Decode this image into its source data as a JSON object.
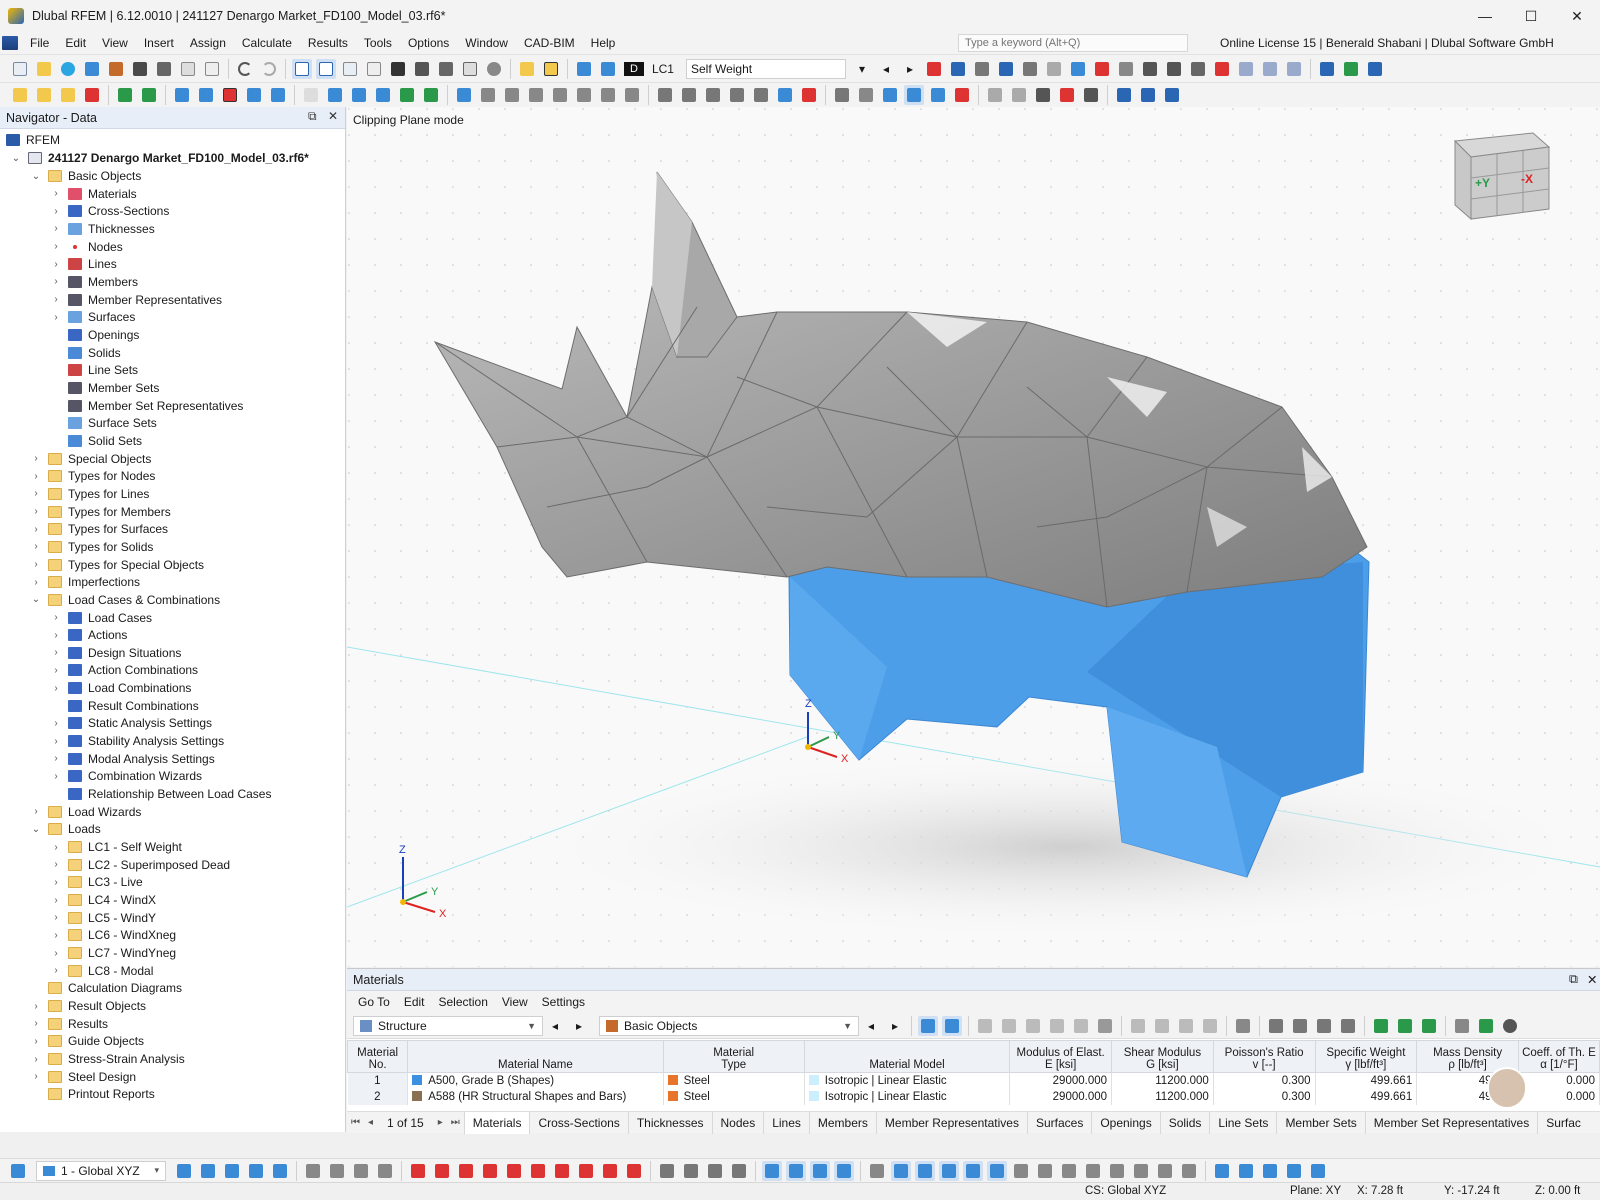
{
  "window": {
    "title": "Dlubal RFEM | 6.12.0010 | 241127 Denargo Market_FD100_Model_03.rf6*",
    "controls": [
      "—",
      "☐",
      "✕"
    ]
  },
  "menu": {
    "items": [
      "File",
      "Edit",
      "View",
      "Insert",
      "Assign",
      "Calculate",
      "Results",
      "Tools",
      "Options",
      "Window",
      "CAD-BIM",
      "Help"
    ],
    "search_placeholder": "Type a keyword (Alt+Q)",
    "license": "Online License 15 | Benerald Shabani | Dlubal Software GmbH"
  },
  "toolbar": {
    "load_case_badge": "D",
    "load_case_id": "LC1",
    "load_case_name": "Self Weight"
  },
  "navigator": {
    "title": "Navigator - Data",
    "root": "RFEM",
    "file": "241127 Denargo Market_FD100_Model_03.rf6*",
    "items": [
      {
        "label": "Basic Objects",
        "level": 1,
        "exp": "open",
        "icon": "folder"
      },
      {
        "label": "Materials",
        "level": 2,
        "exp": "closed",
        "icon": "materials"
      },
      {
        "label": "Cross-Sections",
        "level": 2,
        "exp": "closed",
        "icon": "cross-section"
      },
      {
        "label": "Thicknesses",
        "level": 2,
        "exp": "closed",
        "icon": "thickness"
      },
      {
        "label": "Nodes",
        "level": 2,
        "exp": "closed",
        "icon": "node"
      },
      {
        "label": "Lines",
        "level": 2,
        "exp": "closed",
        "icon": "line"
      },
      {
        "label": "Members",
        "level": 2,
        "exp": "closed",
        "icon": "member"
      },
      {
        "label": "Member Representatives",
        "level": 2,
        "exp": "closed",
        "icon": "member"
      },
      {
        "label": "Surfaces",
        "level": 2,
        "exp": "closed",
        "icon": "surface"
      },
      {
        "label": "Openings",
        "level": 2,
        "exp": "none",
        "icon": "opening"
      },
      {
        "label": "Solids",
        "level": 2,
        "exp": "none",
        "icon": "solid"
      },
      {
        "label": "Line Sets",
        "level": 2,
        "exp": "none",
        "icon": "line"
      },
      {
        "label": "Member Sets",
        "level": 2,
        "exp": "none",
        "icon": "member"
      },
      {
        "label": "Member Set Representatives",
        "level": 2,
        "exp": "none",
        "icon": "member"
      },
      {
        "label": "Surface Sets",
        "level": 2,
        "exp": "none",
        "icon": "surface"
      },
      {
        "label": "Solid Sets",
        "level": 2,
        "exp": "none",
        "icon": "solid"
      },
      {
        "label": "Special Objects",
        "level": 1,
        "exp": "closed",
        "icon": "folder"
      },
      {
        "label": "Types for Nodes",
        "level": 1,
        "exp": "closed",
        "icon": "folder"
      },
      {
        "label": "Types for Lines",
        "level": 1,
        "exp": "closed",
        "icon": "folder"
      },
      {
        "label": "Types for Members",
        "level": 1,
        "exp": "closed",
        "icon": "folder"
      },
      {
        "label": "Types for Surfaces",
        "level": 1,
        "exp": "closed",
        "icon": "folder"
      },
      {
        "label": "Types for Solids",
        "level": 1,
        "exp": "closed",
        "icon": "folder"
      },
      {
        "label": "Types for Special Objects",
        "level": 1,
        "exp": "closed",
        "icon": "folder"
      },
      {
        "label": "Imperfections",
        "level": 1,
        "exp": "closed",
        "icon": "folder"
      },
      {
        "label": "Load Cases & Combinations",
        "level": 1,
        "exp": "open",
        "icon": "folder"
      },
      {
        "label": "Load Cases",
        "level": 2,
        "exp": "closed",
        "icon": "loadcase"
      },
      {
        "label": "Actions",
        "level": 2,
        "exp": "closed",
        "icon": "loadcase"
      },
      {
        "label": "Design Situations",
        "level": 2,
        "exp": "closed",
        "icon": "loadcase"
      },
      {
        "label": "Action Combinations",
        "level": 2,
        "exp": "closed",
        "icon": "loadcase"
      },
      {
        "label": "Load Combinations",
        "level": 2,
        "exp": "closed",
        "icon": "loadcase"
      },
      {
        "label": "Result Combinations",
        "level": 2,
        "exp": "none",
        "icon": "loadcase"
      },
      {
        "label": "Static Analysis Settings",
        "level": 2,
        "exp": "closed",
        "icon": "settings"
      },
      {
        "label": "Stability Analysis Settings",
        "level": 2,
        "exp": "closed",
        "icon": "settings"
      },
      {
        "label": "Modal Analysis Settings",
        "level": 2,
        "exp": "closed",
        "icon": "settings"
      },
      {
        "label": "Combination Wizards",
        "level": 2,
        "exp": "closed",
        "icon": "loadcase"
      },
      {
        "label": "Relationship Between Load Cases",
        "level": 2,
        "exp": "none",
        "icon": "loadcase"
      },
      {
        "label": "Load Wizards",
        "level": 1,
        "exp": "closed",
        "icon": "folder"
      },
      {
        "label": "Loads",
        "level": 1,
        "exp": "open",
        "icon": "folder"
      },
      {
        "label": "LC1 - Self Weight",
        "level": 2,
        "exp": "closed",
        "icon": "folder"
      },
      {
        "label": "LC2 - Superimposed Dead",
        "level": 2,
        "exp": "closed",
        "icon": "folder"
      },
      {
        "label": "LC3 - Live",
        "level": 2,
        "exp": "closed",
        "icon": "folder"
      },
      {
        "label": "LC4 - WindX",
        "level": 2,
        "exp": "closed",
        "icon": "folder"
      },
      {
        "label": "LC5 - WindY",
        "level": 2,
        "exp": "closed",
        "icon": "folder"
      },
      {
        "label": "LC6 - WindXneg",
        "level": 2,
        "exp": "closed",
        "icon": "folder"
      },
      {
        "label": "LC7 - WindYneg",
        "level": 2,
        "exp": "closed",
        "icon": "folder"
      },
      {
        "label": "LC8 - Modal",
        "level": 2,
        "exp": "closed",
        "icon": "folder"
      },
      {
        "label": "Calculation Diagrams",
        "level": 1,
        "exp": "none",
        "icon": "folder"
      },
      {
        "label": "Result Objects",
        "level": 1,
        "exp": "closed",
        "icon": "folder"
      },
      {
        "label": "Results",
        "level": 1,
        "exp": "closed",
        "icon": "folder"
      },
      {
        "label": "Guide Objects",
        "level": 1,
        "exp": "closed",
        "icon": "folder"
      },
      {
        "label": "Stress-Strain Analysis",
        "level": 1,
        "exp": "closed",
        "icon": "folder"
      },
      {
        "label": "Steel Design",
        "level": 1,
        "exp": "closed",
        "icon": "folder"
      },
      {
        "label": "Printout Reports",
        "level": 1,
        "exp": "none",
        "icon": "folder"
      }
    ]
  },
  "viewport": {
    "mode_label": "Clipping Plane mode",
    "cube_labels": {
      "y": "+Y",
      "x": "-X"
    },
    "axes": {
      "z": "Z",
      "y": "Y",
      "x": "X"
    }
  },
  "materials_panel": {
    "title": "Materials",
    "menu": [
      "Go To",
      "Edit",
      "Selection",
      "View",
      "Settings"
    ],
    "combo_left": "Structure",
    "combo_right": "Basic Objects",
    "columns": [
      {
        "line1": "Material",
        "line2": "No."
      },
      {
        "line1": "",
        "line2": "Material Name"
      },
      {
        "line1": "Material",
        "line2": "Type"
      },
      {
        "line1": "",
        "line2": "Material Model"
      },
      {
        "line1": "Modulus of Elast.",
        "line2": "E [ksi]"
      },
      {
        "line1": "Shear Modulus",
        "line2": "G [ksi]"
      },
      {
        "line1": "Poisson's Ratio",
        "line2": "v [--]"
      },
      {
        "line1": "Specific Weight",
        "line2": "γ [lbf/ft³]"
      },
      {
        "line1": "Mass Density",
        "line2": "ρ [lb/ft³]"
      },
      {
        "line1": "Coeff. of Th. E",
        "line2": "α [1/°F]"
      }
    ],
    "rows": [
      {
        "no": "1",
        "name": "A500, Grade B (Shapes)",
        "name_color": "#3d8fe0",
        "type": "Steel",
        "type_color": "#e8742a",
        "model": "Isotropic | Linear Elastic",
        "model_color": "#cdeffd",
        "E": "29000.000",
        "G": "11200.000",
        "nu": "0.300",
        "gamma": "499.661",
        "rho": "490.00",
        "alpha": "0.000"
      },
      {
        "no": "2",
        "name": "A588 (HR Structural Shapes and Bars)",
        "name_color": "#8b6f52",
        "type": "Steel",
        "type_color": "#e8742a",
        "model": "Isotropic | Linear Elastic",
        "model_color": "#cdeffd",
        "E": "29000.000",
        "G": "11200.000",
        "nu": "0.300",
        "gamma": "499.661",
        "rho": "490.00",
        "alpha": "0.000"
      }
    ],
    "pager": "1 of 15",
    "tabs": [
      "Materials",
      "Cross-Sections",
      "Thicknesses",
      "Nodes",
      "Lines",
      "Members",
      "Member Representatives",
      "Surfaces",
      "Openings",
      "Solids",
      "Line Sets",
      "Member Sets",
      "Member Set Representatives",
      "Surfac"
    ]
  },
  "bottom": {
    "coord_system": "1 - Global XYZ"
  },
  "status": {
    "cs": "CS: Global XYZ",
    "plane": "Plane: XY",
    "x": "X: 7.28 ft",
    "y": "Y: -17.24 ft",
    "z": "Z: 0.00 ft"
  },
  "colors": {
    "accent": "#2a66b4",
    "legs_blue": "#4d9ee8",
    "steel_gray": "#9a9a9a"
  }
}
